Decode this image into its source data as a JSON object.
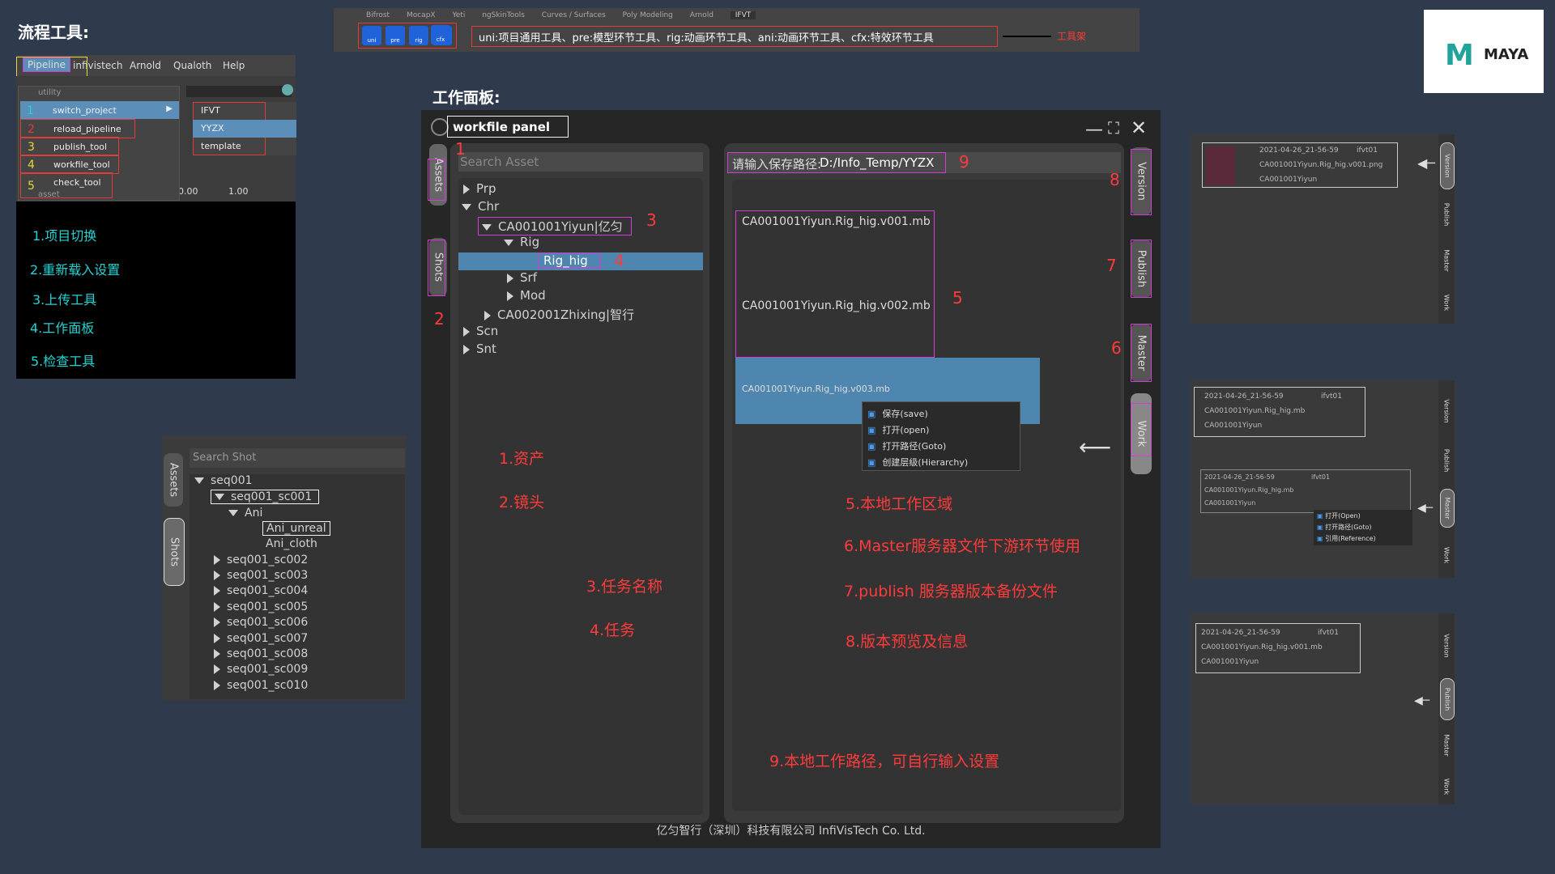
{
  "section1": {
    "title": "流程工具:",
    "menu": [
      "Pipeline",
      "infivistech",
      "Arnold",
      "Qualoth",
      "Help"
    ],
    "utility": "utility",
    "asset": "asset",
    "items": [
      {
        "num": "1",
        "label": "switch_project"
      },
      {
        "num": "2",
        "label": "reload_pipeline"
      },
      {
        "num": "3",
        "label": "publish_tool"
      },
      {
        "num": "4",
        "label": "workfile_tool"
      },
      {
        "num": "5",
        "label": "check_tool"
      }
    ],
    "submenu": [
      "IFVT",
      "YYZX",
      "template"
    ],
    "field1": "0.00",
    "field2": "1.00",
    "legend": [
      "1.项目切换",
      "2.重新载入设置",
      "3.上传工具",
      "4.工作面板",
      "5.检查工具"
    ]
  },
  "shelf": {
    "tabs": [
      "Bifrost",
      "MocapX",
      "Yeti",
      "ngSkinTools",
      "Curves / Surfaces",
      "Poly Modeling",
      "Arnold",
      "IFVT"
    ],
    "buttons": [
      "uni",
      "pre",
      "rig",
      "ani",
      "cfx"
    ],
    "desc": "uni:项目通用工具、pre:模型环节工具、rig:动画环节工具、ani:动画环节工具、cfx:特效环节工具",
    "label": "工具架"
  },
  "logo": {
    "text": "MAYA"
  },
  "shot_panel": {
    "search": "Search Shot",
    "tabs": [
      "Assets",
      "Shots"
    ],
    "seq": "seq001",
    "selected": "seq001_sc001",
    "ani": "Ani",
    "ani_children": [
      "Ani_unreal",
      "Ani_cloth"
    ],
    "others": [
      "seq001_sc002",
      "seq001_sc003",
      "seq001_sc004",
      "seq001_sc005",
      "seq001_sc006",
      "seq001_sc007",
      "seq001_sc008",
      "seq001_sc009",
      "seq001_sc010"
    ]
  },
  "workfile": {
    "heading": "工作面板:",
    "title": "workfile panel",
    "search": "Search Asset",
    "left_tabs": [
      "Assets",
      "Shots"
    ],
    "tree": {
      "prp": "Prp",
      "chr": "Chr",
      "asset1": "CA001001Yiyun|亿匀",
      "rig": "Rig",
      "rig_hig": "Rig_hig",
      "srf": "Srf",
      "mod": "Mod",
      "asset2": "CA002001Zhixing|智行",
      "scn": "Scn",
      "snt": "Snt"
    },
    "path_label": "请输入保存路径:",
    "path_value": "D:/Info_Temp/YYZX",
    "files": [
      "CA001001Yiyun.Rig_hig.v001.mb",
      "CA001001Yiyun.Rig_hig.v002.mb",
      "CA001001Yiyun.Rig_hig.v003.mb"
    ],
    "context_menu": [
      "保存(save)",
      "打开(open)",
      "打开路径(Goto)",
      "创建层级(Hierarchy)"
    ],
    "right_tabs": [
      "Version",
      "Publish",
      "Master",
      "Work"
    ],
    "footer": "亿匀智行（深圳）科技有限公司   InfiVisTech Co. Ltd.",
    "numbers": [
      "1",
      "2",
      "3",
      "4",
      "5",
      "6",
      "7",
      "8",
      "9"
    ],
    "annotations_left": [
      "1.资产",
      "2.镜头",
      "3.任务名称",
      "4.任务"
    ],
    "annotations_right": [
      "5.本地工作区域",
      "6.Master服务器文件下游环节使用",
      "7.publish 服务器版本备份文件",
      "8.版本预览及信息",
      "9.本地工作路径，可自行输入设置"
    ]
  },
  "panel_version": {
    "date": "2021-04-26_21-56-59",
    "user": "ifvt01",
    "file": "CA001001Yiyun.Rig_hig.v001.png",
    "asset": "CA001001Yiyun",
    "tabs": [
      "Version",
      "Publish",
      "Master",
      "Work"
    ]
  },
  "panel_master": {
    "date": "2021-04-26_21-56-59",
    "user": "ifvt01",
    "file": "CA001001Yiyun.Rig_hig.mb",
    "asset": "CA001001Yiyun",
    "menu": [
      "打开(Open)",
      "打开路径(Goto)",
      "引用(Reference)"
    ],
    "tabs": [
      "Version",
      "Publish",
      "Master",
      "Work"
    ]
  },
  "panel_publish": {
    "date": "2021-04-26_21-56-59",
    "user": "ifvt01",
    "file": "CA001001Yiyun.Rig_hig.v001.mb",
    "asset": "CA001001Yiyun",
    "tabs": [
      "Version",
      "Publish",
      "Master",
      "Work"
    ]
  }
}
